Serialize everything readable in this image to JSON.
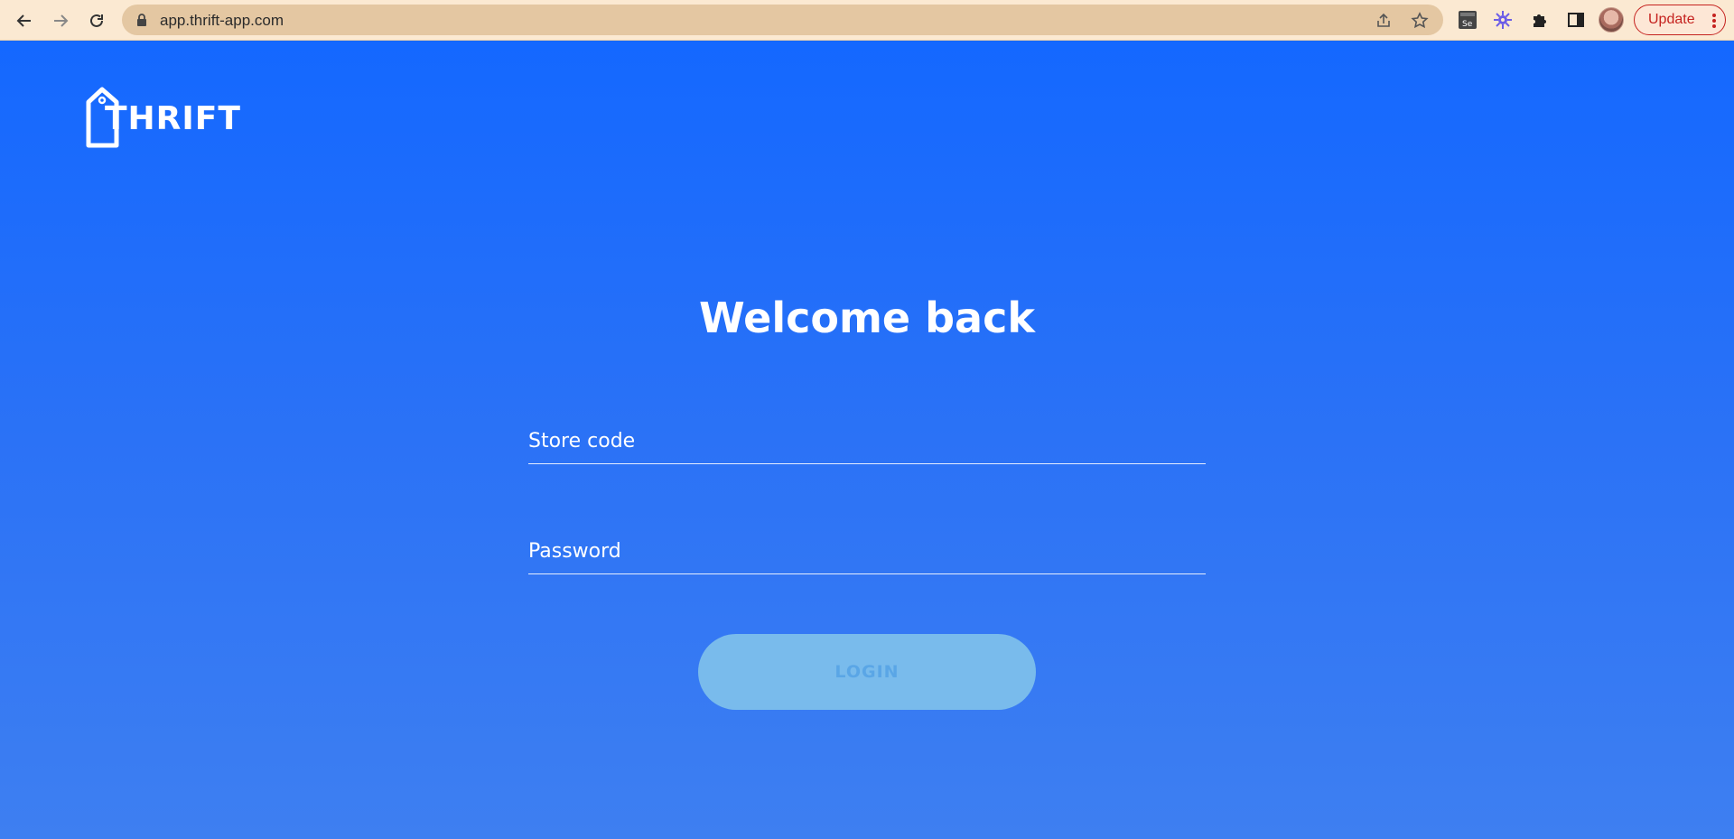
{
  "browser": {
    "url": "app.thrift-app.com",
    "update_label": "Update",
    "extensions": [
      "selenium-icon",
      "gear-flower-icon",
      "puzzle-icon",
      "sidepanel-icon"
    ]
  },
  "logo": {
    "text": "THRIFT"
  },
  "form": {
    "title": "Welcome back",
    "store_code_placeholder": "Store code",
    "password_placeholder": "Password",
    "login_label": "LOGIN"
  },
  "colors": {
    "chrome_bg": "#fbe9d2",
    "page_gradient_top": "#1468ff",
    "page_gradient_bottom": "#3e7ff1",
    "login_button_bg": "#79bbec",
    "login_button_text": "#5aa6e6",
    "update_accent": "#c5221f"
  }
}
